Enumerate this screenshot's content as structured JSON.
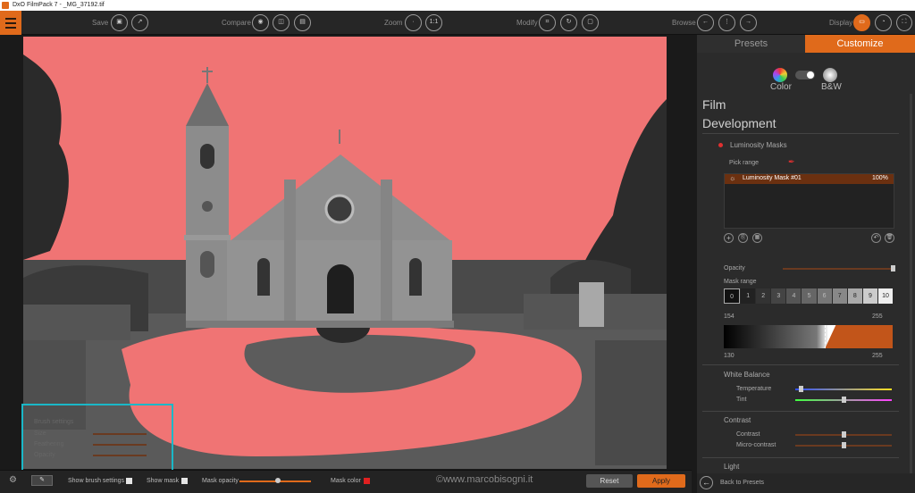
{
  "window": {
    "title": "DxO FilmPack 7 - _MG_37192.tif"
  },
  "toolbar": {
    "save": "Save",
    "compare": "Compare",
    "zoom": "Zoom",
    "zoom_1to1": "1:1",
    "modify": "Modify",
    "browse": "Browse",
    "display": "Display"
  },
  "right_tabs": {
    "presets": "Presets",
    "customize": "Customize"
  },
  "mode": {
    "color": "Color",
    "bw": "B&W"
  },
  "sections": {
    "film": "Film",
    "development": "Development",
    "light": "Light"
  },
  "luminosity": {
    "title": "Luminosity Masks",
    "pick_range": "Pick range",
    "mask_name": "Luminosity Mask #01",
    "mask_pct": "100%",
    "opacity": "Opacity",
    "mask_range": "Mask range",
    "range_steps": [
      "0",
      "1",
      "2",
      "3",
      "4",
      "5",
      "6",
      "7",
      "8",
      "9",
      "10"
    ],
    "low_val": "154",
    "high_val": "255",
    "low_val2": "130",
    "high_val2": "255"
  },
  "white_balance": {
    "title": "White Balance",
    "temperature": "Temperature",
    "tint": "Tint"
  },
  "contrast": {
    "title": "Contrast",
    "contrast": "Contrast",
    "micro": "Micro-contrast"
  },
  "back": "Back to Presets",
  "brush": {
    "title": "Brush settings",
    "size": "Size",
    "feathering": "Feathering",
    "opacity": "Opacity"
  },
  "bottom": {
    "show_brush": "Show brush settings",
    "show_mask": "Show mask",
    "mask_opacity": "Mask opacity",
    "mask_color": "Mask color",
    "reset": "Reset",
    "apply": "Apply",
    "watermark": "©www.marcobisogni.it"
  },
  "colors": {
    "accent": "#e06a1b",
    "mask": "#f07272",
    "highlight": "#1ab8c8"
  }
}
